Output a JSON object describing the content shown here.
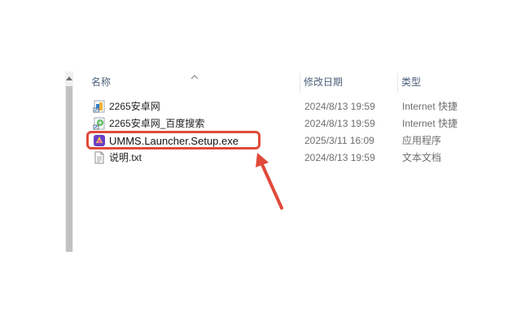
{
  "columns": {
    "name": "名称",
    "date": "修改日期",
    "type": "类型"
  },
  "files": [
    {
      "name": "2265安卓网",
      "date": "2024/8/13 19:59",
      "type": "Internet 快捷",
      "icon": "internet-shortcut-icon"
    },
    {
      "name": "2265安卓网_百度搜索",
      "date": "2024/8/13 19:59",
      "type": "Internet 快捷",
      "icon": "internet-shortcut-icon"
    },
    {
      "name": "UMMS.Launcher.Setup.exe",
      "date": "2025/3/11 16:09",
      "type": "应用程序",
      "icon": "app-installer-icon"
    },
    {
      "name": "说明.txt",
      "date": "2024/8/13 19:59",
      "type": "文本文档",
      "icon": "text-file-icon"
    }
  ],
  "highlight": {
    "color": "#e04a3a",
    "target": "UMMS.Launcher.Setup.exe"
  }
}
